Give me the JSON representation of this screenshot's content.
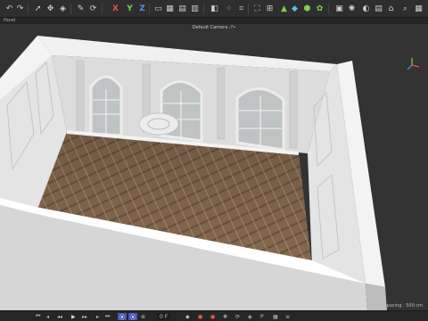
{
  "toolbar": {
    "axis_x_label": "X",
    "axis_y_label": "Y",
    "axis_z_label": "Z",
    "icons": [
      "undo-icon",
      "redo-icon",
      "select-icon",
      "move-icon",
      "scale-icon",
      "rotate-icon",
      "pen-icon",
      "model-icon",
      "frame-icon",
      "render-region-icon",
      "render-icon",
      "render-settings-icon",
      "cube-icon",
      "spline-icon",
      "subdivision-icon",
      "array-icon",
      "camera-icon",
      "light-icon"
    ]
  },
  "panel": {
    "label": "Panel"
  },
  "viewport": {
    "camera_label": "Default Camera :?•",
    "grid_label": "Grid Spacing : 500 cm"
  },
  "timeline": {
    "frame_field": "0 F",
    "icons": [
      "first-frame-icon",
      "prev-key-icon",
      "prev-frame-icon",
      "play-icon",
      "next-frame-icon",
      "next-key-icon",
      "last-frame-icon"
    ]
  },
  "colors": {
    "background": "#333333",
    "wall": "#e6e6e6",
    "floor": "#8a6e55",
    "accent": "#4b55b8"
  }
}
